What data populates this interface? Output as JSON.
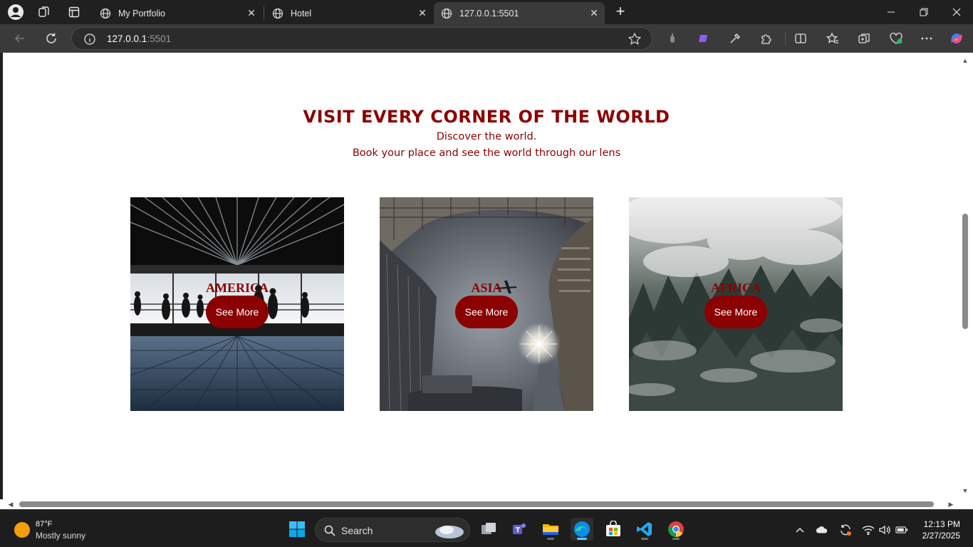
{
  "browser": {
    "tabs": [
      {
        "title": "My Portfolio",
        "active": false
      },
      {
        "title": "Hotel",
        "active": false
      },
      {
        "title": "127.0.0.1:5501",
        "active": true
      }
    ],
    "address": {
      "host": "127.0.0.1",
      "port": ":5501"
    }
  },
  "page": {
    "title": "VISIT EVERY CORNER OF THE WORLD",
    "subtitle": "Discover the world.",
    "tagline": "Book your place and see the world through our lens",
    "cards": [
      {
        "label": "AMERICA",
        "button": "See More",
        "photo": "airport-terminal-silhouettes"
      },
      {
        "label": "ASIA",
        "button": "See More",
        "photo": "skyscrapers-looking-up-with-plane"
      },
      {
        "label": "AFRICA",
        "button": "See More",
        "photo": "misty-forest-aerial"
      }
    ],
    "accent_color": "#8b0000"
  },
  "taskbar": {
    "weather": {
      "temp": "87°F",
      "desc": "Mostly sunny"
    },
    "search_label": "Search",
    "apps": [
      "task-view",
      "teams",
      "file-explorer",
      "edge",
      "microsoft-store",
      "vscode",
      "chrome"
    ],
    "clock": {
      "time": "12:13 PM",
      "date": "2/27/2025"
    }
  }
}
